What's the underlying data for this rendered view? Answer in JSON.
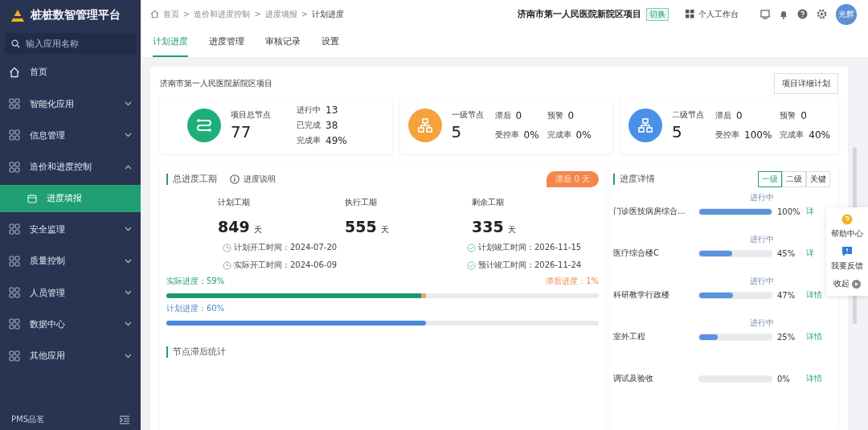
{
  "sidebar": {
    "logo": "桩桩数智管理平台",
    "search": {
      "placeholder": "输入应用名称"
    },
    "items": [
      {
        "label": "首页",
        "kind": "home"
      },
      {
        "label": "智能化应用",
        "kind": "group",
        "expanded": false
      },
      {
        "label": "信息管理",
        "kind": "group",
        "expanded": false
      },
      {
        "label": "造价和进度控制",
        "kind": "group",
        "expanded": true,
        "children": [
          {
            "label": "进度填报",
            "selected": true
          }
        ]
      },
      {
        "label": "安全监理",
        "kind": "group",
        "expanded": false
      },
      {
        "label": "质量控制",
        "kind": "group",
        "expanded": false
      },
      {
        "label": "人员管理",
        "kind": "group",
        "expanded": false
      },
      {
        "label": "数据中心",
        "kind": "group",
        "expanded": false
      },
      {
        "label": "其他应用",
        "kind": "group",
        "expanded": false
      }
    ],
    "footer": "PMS品茗"
  },
  "header": {
    "breadcrumb": [
      "首页",
      "造价和进度控制",
      "进度填报",
      "计划进度"
    ],
    "separator": ">",
    "project": "济南市第一人民医院新院区项目",
    "switch": "切换",
    "workspace": "个人工作台",
    "avatar": "光辉"
  },
  "tabs": [
    {
      "label": "计划进度",
      "selected": true
    },
    {
      "label": "进度管理",
      "selected": false
    },
    {
      "label": "审核记录",
      "selected": false
    },
    {
      "label": "设置",
      "selected": false
    }
  ],
  "overview": {
    "title": "济南市第一人民医院新院区项目",
    "button": "项目详细计划",
    "cards": [
      {
        "kind": "total",
        "color": "#1fae7a",
        "label": "项目总节点",
        "value": "77",
        "stats": [
          {
            "label": "进行中",
            "value": "13"
          },
          {
            "label": "已完成",
            "value": "38"
          },
          {
            "label": "完成率",
            "value": "49%"
          }
        ]
      },
      {
        "kind": "level",
        "color": "#f5a23a",
        "label": "一级节点",
        "value": "5",
        "stats": [
          {
            "label": "滞后",
            "value": "0"
          },
          {
            "label": "预警",
            "value": "0"
          },
          {
            "label": "受控率",
            "value": "0%"
          },
          {
            "label": "完成率",
            "value": "0%"
          }
        ]
      },
      {
        "kind": "level",
        "color": "#4a90e8",
        "label": "二级节点",
        "value": "5",
        "stats": [
          {
            "label": "滞后",
            "value": "0"
          },
          {
            "label": "预警",
            "value": "0"
          },
          {
            "label": "受控率",
            "value": "100%"
          },
          {
            "label": "完成率",
            "value": "40%"
          }
        ]
      }
    ]
  },
  "schedule": {
    "title": "总进度工期",
    "note": "进度说明",
    "badge": "滞后 0 天",
    "periods": [
      {
        "label": "计划工期",
        "value": "849",
        "unit": "天"
      },
      {
        "label": "执行工期",
        "value": "555",
        "unit": "天"
      },
      {
        "label": "剩余工期",
        "value": "335",
        "unit": "天"
      }
    ],
    "dates": [
      {
        "kind": "start",
        "text": "计划开工时间：2024-07-20"
      },
      {
        "kind": "end",
        "text": "计划竣工时间：2026-11-15"
      },
      {
        "kind": "start",
        "text": "实际开工时间：2024-06-09"
      },
      {
        "kind": "end",
        "text": "预计竣工时间：2026-11-24"
      }
    ],
    "actual": {
      "label": "实际进度：59%",
      "level": 0.59,
      "lag": {
        "label": "滞后进度：1%",
        "level": 0.01
      }
    },
    "plan": {
      "label": "计划进度：60%",
      "level": 0.6
    }
  },
  "lag_stats": {
    "title": "节点滞后统计"
  },
  "details": {
    "title": "进度详情",
    "filters": [
      {
        "label": "一级",
        "selected": true
      },
      {
        "label": "二级",
        "selected": false
      },
      {
        "label": "关键",
        "selected": false
      }
    ],
    "rows": [
      {
        "name": "门诊医技病房综合...",
        "status": "进行中",
        "level": 1.0,
        "percent": "100%",
        "link": "详"
      },
      {
        "name": "医疗综合楼C",
        "status": "进行中",
        "level": 0.45,
        "percent": "45%",
        "link": "详"
      },
      {
        "name": "科研教学行政楼",
        "status": "进行中",
        "level": 0.47,
        "percent": "47%",
        "link": "详情"
      },
      {
        "name": "室外工程",
        "status": "进行中",
        "level": 0.25,
        "percent": "25%",
        "link": "详情"
      },
      {
        "name": "调试及验收",
        "level": 0.0,
        "percent": "0%",
        "link": "详情"
      }
    ]
  },
  "float_panel": {
    "help": "帮助中心",
    "feedback": "我要反馈",
    "collapse": "收起"
  }
}
